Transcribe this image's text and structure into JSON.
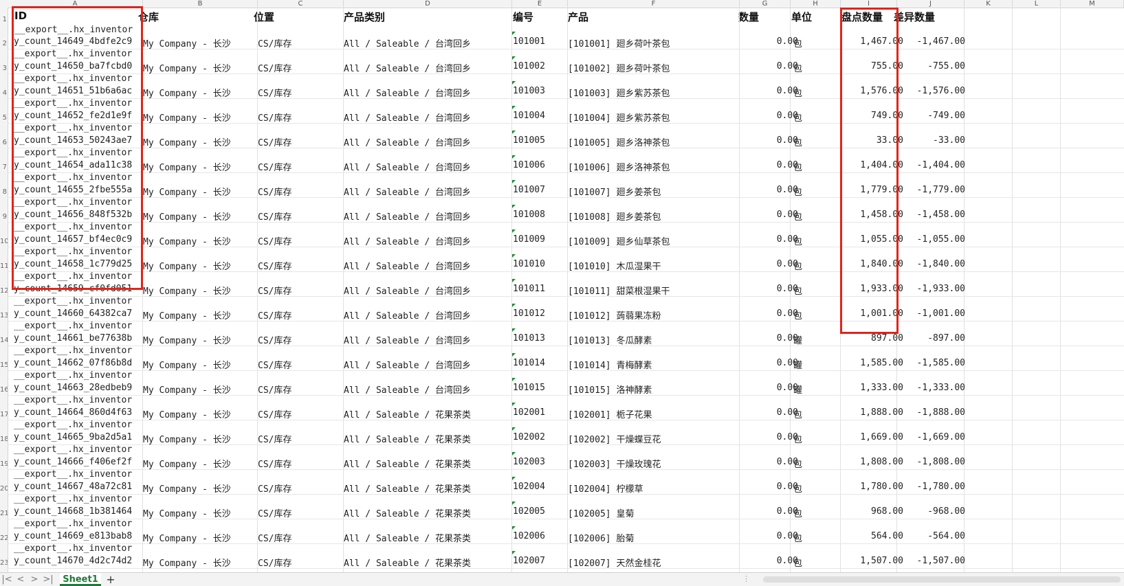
{
  "column_letters": [
    "A",
    "B",
    "C",
    "D",
    "E",
    "F",
    "G",
    "H",
    "I",
    "J",
    "K",
    "L",
    "M"
  ],
  "header_row": {
    "row_num": "1",
    "id": "ID",
    "warehouse": "仓库",
    "location": "位置",
    "category": "产品类别",
    "code": "编号",
    "product": "产品",
    "quantity": "数量",
    "unit": "单位",
    "count_qty": "盘点数量",
    "diff_qty": "差异数量"
  },
  "top_partial_line": "__export__.hx_inventor",
  "rows": [
    {
      "row_num": "2",
      "id": "y_count_14649_4bdfe2c9",
      "id_next": "__export__.hx_inventor",
      "warehouse": "My Company - 长沙",
      "location": "CS/库存",
      "category": "All / Saleable / 台湾回乡",
      "code": "101001",
      "product": "[101001] 廻乡荷叶茶包",
      "quantity": "0.00",
      "unit": "包",
      "count_qty": "1,467.00",
      "diff_qty": "-1,467.00"
    },
    {
      "row_num": "3",
      "id": "y_count_14650_ba7fcbd0",
      "id_next": "__export__.hx_inventor",
      "warehouse": "My Company - 长沙",
      "location": "CS/库存",
      "category": "All / Saleable / 台湾回乡",
      "code": "101002",
      "product": "[101002] 廻乡荷叶茶包",
      "quantity": "0.00",
      "unit": "包",
      "count_qty": "755.00",
      "diff_qty": "-755.00"
    },
    {
      "row_num": "4",
      "id": "y_count_14651_51b6a6ac",
      "id_next": "__export__.hx_inventor",
      "warehouse": "My Company - 长沙",
      "location": "CS/库存",
      "category": "All / Saleable / 台湾回乡",
      "code": "101003",
      "product": "[101003] 廻乡紫苏茶包",
      "quantity": "0.00",
      "unit": "包",
      "count_qty": "1,576.00",
      "diff_qty": "-1,576.00"
    },
    {
      "row_num": "5",
      "id": "y_count_14652_fe2d1e9f",
      "id_next": "__export__.hx_inventor",
      "warehouse": "My Company - 长沙",
      "location": "CS/库存",
      "category": "All / Saleable / 台湾回乡",
      "code": "101004",
      "product": "[101004] 廻乡紫苏茶包",
      "quantity": "0.00",
      "unit": "包",
      "count_qty": "749.00",
      "diff_qty": "-749.00"
    },
    {
      "row_num": "6",
      "id": "y_count_14653_50243ae7",
      "id_next": "__export__.hx_inventor",
      "warehouse": "My Company - 长沙",
      "location": "CS/库存",
      "category": "All / Saleable / 台湾回乡",
      "code": "101005",
      "product": "[101005] 廻乡洛神茶包",
      "quantity": "0.00",
      "unit": "包",
      "count_qty": "33.00",
      "diff_qty": "-33.00"
    },
    {
      "row_num": "7",
      "id": "y_count_14654_ada11c38",
      "id_next": "__export__.hx_inventor",
      "warehouse": "My Company - 长沙",
      "location": "CS/库存",
      "category": "All / Saleable / 台湾回乡",
      "code": "101006",
      "product": "[101006] 廻乡洛神茶包",
      "quantity": "0.00",
      "unit": "包",
      "count_qty": "1,404.00",
      "diff_qty": "-1,404.00"
    },
    {
      "row_num": "8",
      "id": "y_count_14655_2fbe555a",
      "id_next": "__export__.hx_inventor",
      "warehouse": "My Company - 长沙",
      "location": "CS/库存",
      "category": "All / Saleable / 台湾回乡",
      "code": "101007",
      "product": "[101007] 廻乡姜茶包",
      "quantity": "0.00",
      "unit": "包",
      "count_qty": "1,779.00",
      "diff_qty": "-1,779.00"
    },
    {
      "row_num": "9",
      "id": "y_count_14656_848f532b",
      "id_next": "__export__.hx_inventor",
      "warehouse": "My Company - 长沙",
      "location": "CS/库存",
      "category": "All / Saleable / 台湾回乡",
      "code": "101008",
      "product": "[101008] 廻乡姜茶包",
      "quantity": "0.00",
      "unit": "包",
      "count_qty": "1,458.00",
      "diff_qty": "-1,458.00"
    },
    {
      "row_num": "10",
      "id": "y_count_14657_bf4ec0c9",
      "id_next": "__export__.hx_inventor",
      "warehouse": "My Company - 长沙",
      "location": "CS/库存",
      "category": "All / Saleable / 台湾回乡",
      "code": "101009",
      "product": "[101009] 廻乡仙草茶包",
      "quantity": "0.00",
      "unit": "包",
      "count_qty": "1,055.00",
      "diff_qty": "-1,055.00"
    },
    {
      "row_num": "11",
      "id": "y_count_14658_1c779d25",
      "id_next": "__export__.hx_inventor",
      "warehouse": "My Company - 长沙",
      "location": "CS/库存",
      "category": "All / Saleable / 台湾回乡",
      "code": "101010",
      "product": "[101010] 木瓜湿果干",
      "quantity": "0.00",
      "unit": "包",
      "count_qty": "1,840.00",
      "diff_qty": "-1,840.00"
    },
    {
      "row_num": "12",
      "id": "y_count_14659_cf0fd051",
      "id_next": "__export__.hx_inventor",
      "warehouse": "My Company - 长沙",
      "location": "CS/库存",
      "category": "All / Saleable / 台湾回乡",
      "code": "101011",
      "product": "[101011] 甜菜根湿果干",
      "quantity": "0.00",
      "unit": "包",
      "count_qty": "1,933.00",
      "diff_qty": "-1,933.00"
    },
    {
      "row_num": "13",
      "id": "y_count_14660_64382ca7",
      "id_next": "__export__.hx_inventor",
      "warehouse": "My Company - 长沙",
      "location": "CS/库存",
      "category": "All / Saleable / 台湾回乡",
      "code": "101012",
      "product": "[101012] 蒟蒻果冻粉",
      "quantity": "0.00",
      "unit": "包",
      "count_qty": "1,001.00",
      "diff_qty": "-1,001.00"
    },
    {
      "row_num": "14",
      "id": "y_count_14661_be77638b",
      "id_next": "__export__.hx_inventor",
      "warehouse": "My Company - 长沙",
      "location": "CS/库存",
      "category": "All / Saleable / 台湾回乡",
      "code": "101013",
      "product": "[101013] 冬瓜酵素",
      "quantity": "0.00",
      "unit": "罐",
      "count_qty": "897.00",
      "diff_qty": "-897.00"
    },
    {
      "row_num": "15",
      "id": "y_count_14662_07f86b8d",
      "id_next": "__export__.hx_inventor",
      "warehouse": "My Company - 长沙",
      "location": "CS/库存",
      "category": "All / Saleable / 台湾回乡",
      "code": "101014",
      "product": "[101014] 青梅酵素",
      "quantity": "0.00",
      "unit": "罐",
      "count_qty": "1,585.00",
      "diff_qty": "-1,585.00"
    },
    {
      "row_num": "16",
      "id": "y_count_14663_28edbeb9",
      "id_next": "__export__.hx_inventor",
      "warehouse": "My Company - 长沙",
      "location": "CS/库存",
      "category": "All / Saleable / 台湾回乡",
      "code": "101015",
      "product": "[101015] 洛神酵素",
      "quantity": "0.00",
      "unit": "罐",
      "count_qty": "1,333.00",
      "diff_qty": "-1,333.00"
    },
    {
      "row_num": "17",
      "id": "y_count_14664_860d4f63",
      "id_next": "__export__.hx_inventor",
      "warehouse": "My Company - 长沙",
      "location": "CS/库存",
      "category": "All / Saleable / 花果茶类",
      "code": "102001",
      "product": "[102001] 栀子花果",
      "quantity": "0.00",
      "unit": "包",
      "count_qty": "1,888.00",
      "diff_qty": "-1,888.00"
    },
    {
      "row_num": "18",
      "id": "y_count_14665_9ba2d5a1",
      "id_next": "__export__.hx_inventor",
      "warehouse": "My Company - 长沙",
      "location": "CS/库存",
      "category": "All / Saleable / 花果茶类",
      "code": "102002",
      "product": "[102002] 干燥蝶豆花",
      "quantity": "0.00",
      "unit": "包",
      "count_qty": "1,669.00",
      "diff_qty": "-1,669.00"
    },
    {
      "row_num": "19",
      "id": "y_count_14666_f406ef2f",
      "id_next": "__export__.hx_inventor",
      "warehouse": "My Company - 长沙",
      "location": "CS/库存",
      "category": "All / Saleable / 花果茶类",
      "code": "102003",
      "product": "[102003] 干燥玫瑰花",
      "quantity": "0.00",
      "unit": "包",
      "count_qty": "1,808.00",
      "diff_qty": "-1,808.00"
    },
    {
      "row_num": "20",
      "id": "y_count_14667_48a72c81",
      "id_next": "__export__.hx_inventor",
      "warehouse": "My Company - 长沙",
      "location": "CS/库存",
      "category": "All / Saleable / 花果茶类",
      "code": "102004",
      "product": "[102004] 柠檬草",
      "quantity": "0.00",
      "unit": "包",
      "count_qty": "1,780.00",
      "diff_qty": "-1,780.00"
    },
    {
      "row_num": "21",
      "id": "y_count_14668_1b381464",
      "id_next": "__export__.hx_inventor",
      "warehouse": "My Company - 长沙",
      "location": "CS/库存",
      "category": "All / Saleable / 花果茶类",
      "code": "102005",
      "product": "[102005] 皇菊",
      "quantity": "0.00",
      "unit": "包",
      "count_qty": "968.00",
      "diff_qty": "-968.00"
    },
    {
      "row_num": "22",
      "id": "y_count_14669_e813bab8",
      "id_next": "__export__.hx_inventor",
      "warehouse": "My Company - 长沙",
      "location": "CS/库存",
      "category": "All / Saleable / 花果茶类",
      "code": "102006",
      "product": "[102006] 胎菊",
      "quantity": "0.00",
      "unit": "包",
      "count_qty": "564.00",
      "diff_qty": "-564.00"
    },
    {
      "row_num": "23",
      "id": "y_count_14670_4d2c74d2",
      "id_next": "",
      "warehouse": "My Company - 长沙",
      "location": "CS/库存",
      "category": "All / Saleable / 花果茶类",
      "code": "102007",
      "product": "[102007] 天然金桂花",
      "quantity": "0.00",
      "unit": "包",
      "count_qty": "1,507.00",
      "diff_qty": "-1,507.00"
    }
  ],
  "sheetbar": {
    "sheet_name": "Sheet1",
    "add_label": "+",
    "nav_first": "|<",
    "nav_prev": "<",
    "nav_next": ">",
    "nav_last": ">|",
    "scroll_dots": "⋮"
  },
  "colors": {
    "highlight": "#e2231a",
    "sheet_tab": "#1e7a35",
    "triangle": "#1f8a3b"
  }
}
